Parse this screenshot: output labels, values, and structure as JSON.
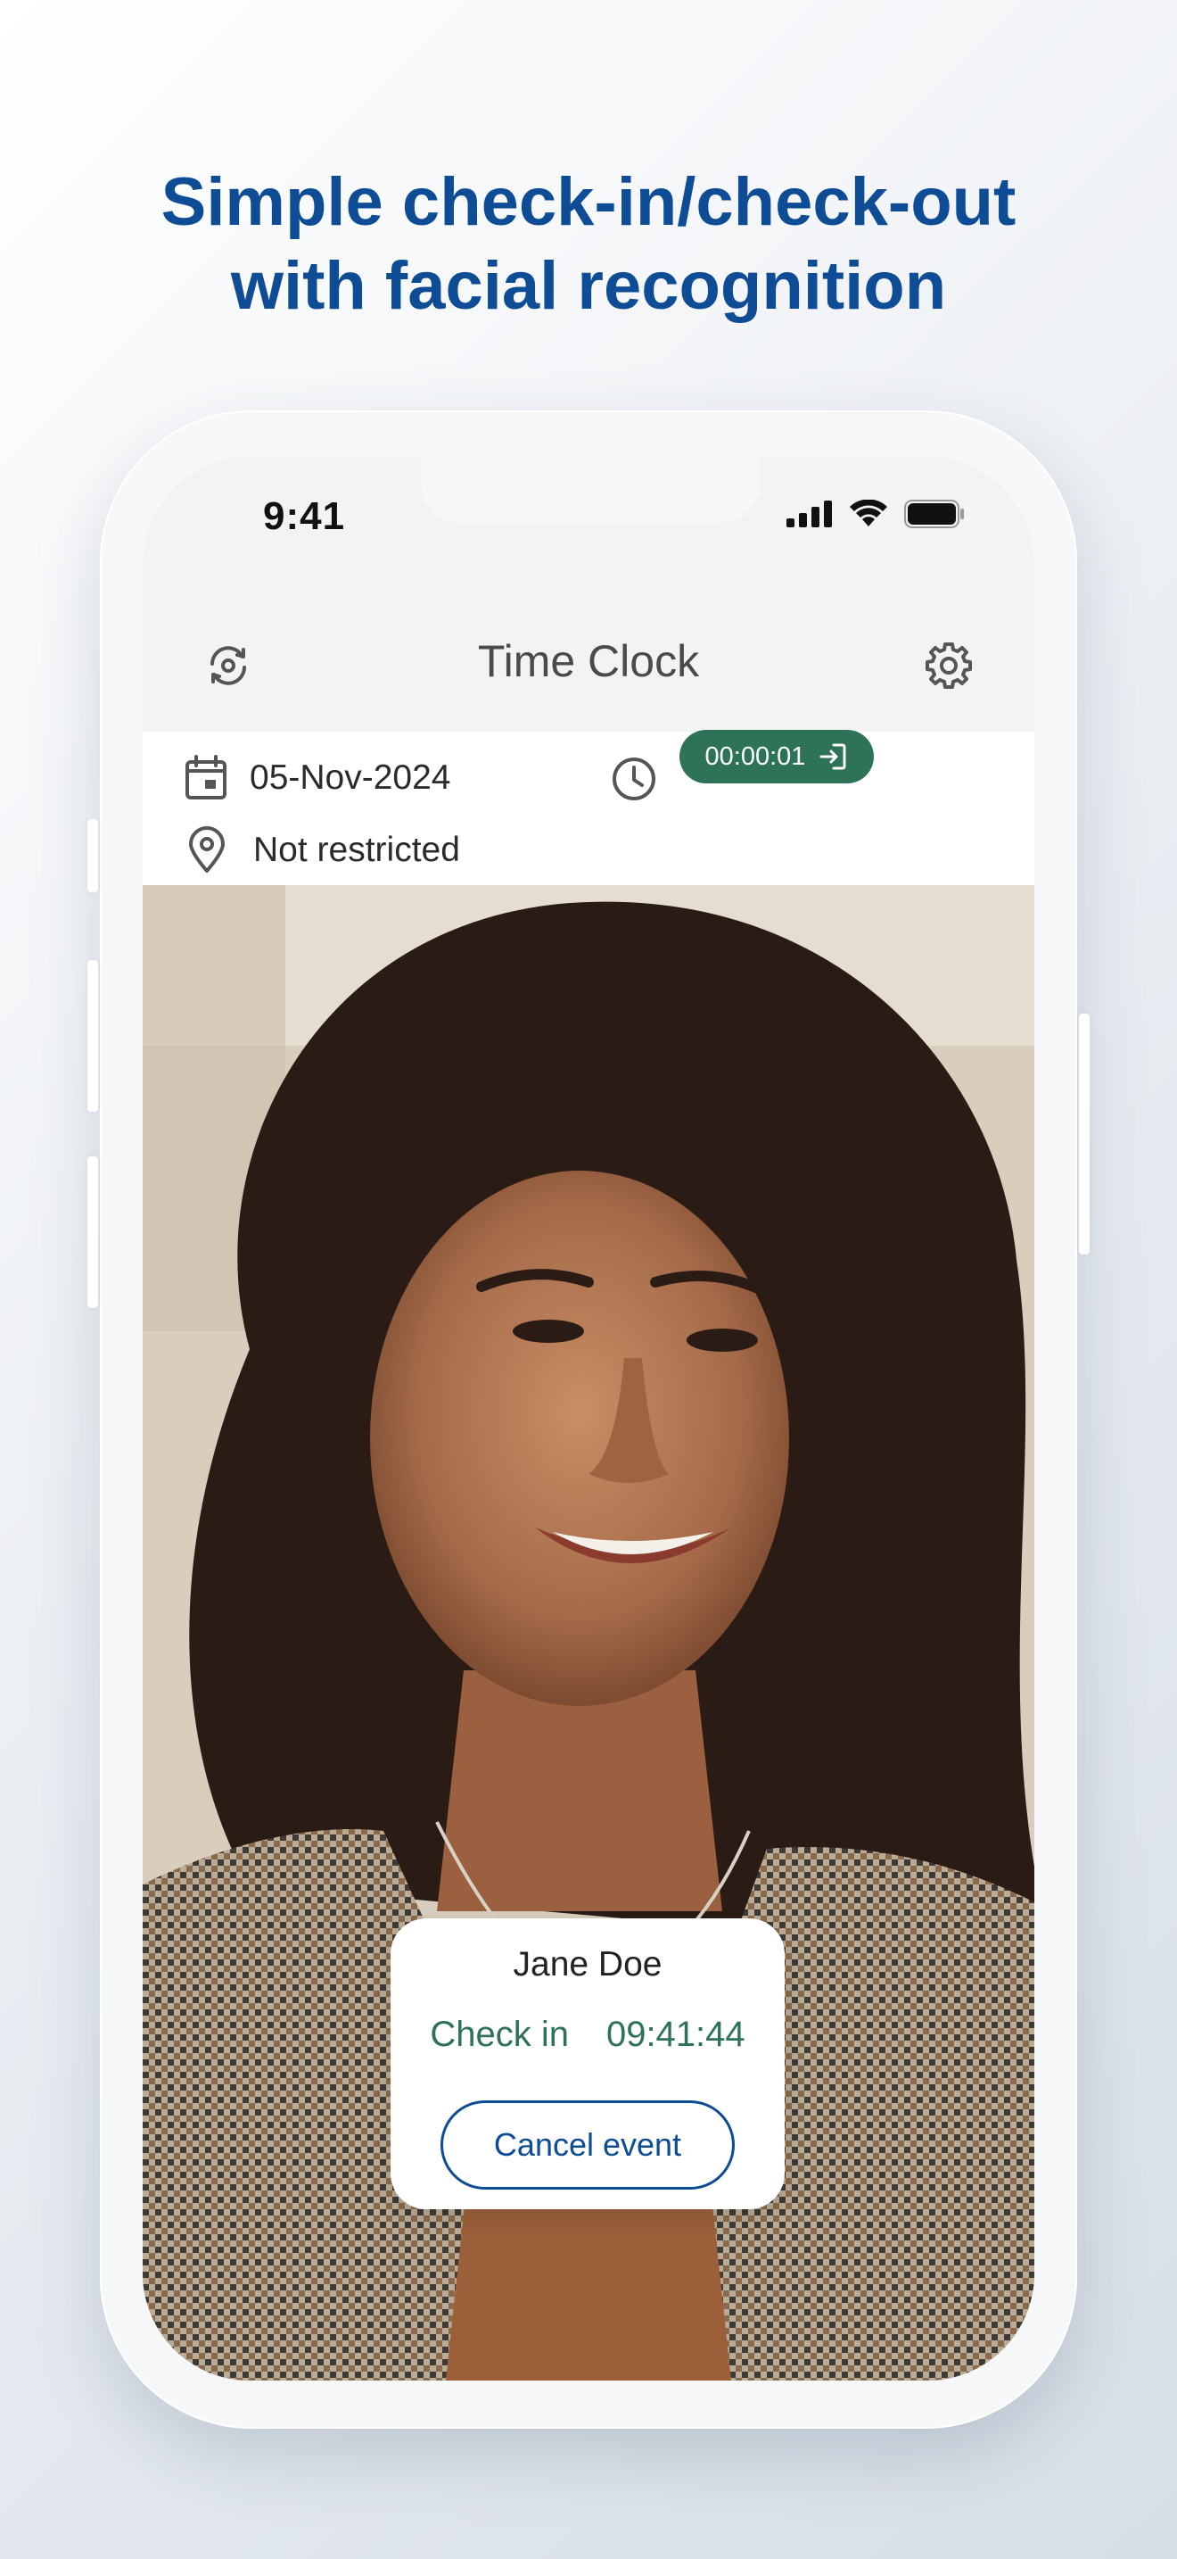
{
  "headline": {
    "line1": "Simple check-in/check-out",
    "line2": "with facial recognition"
  },
  "status_bar": {
    "time": "9:41"
  },
  "app_bar": {
    "title": "Time Clock",
    "left_icon": "refresh-camera-icon",
    "right_icon": "gear-icon"
  },
  "info": {
    "date": "05-Nov-2024",
    "location": "Not restricted",
    "timer": "00:00:01"
  },
  "event_card": {
    "name": "Jane Doe",
    "event_type": "Check in",
    "event_time": "09:41:44",
    "cancel_label": "Cancel event"
  },
  "colors": {
    "headline": "#0e4c96",
    "accent_green": "#2e7257",
    "button_blue": "#0e4c96"
  }
}
